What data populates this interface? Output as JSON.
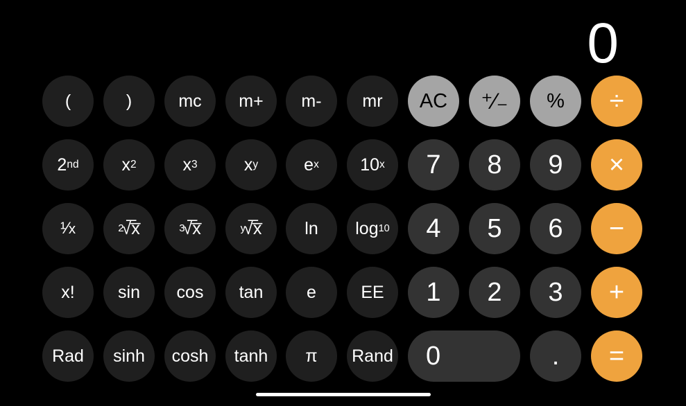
{
  "app": {
    "name": "Calculator",
    "mode": "scientific",
    "background_color": "#000000"
  },
  "display": {
    "value": "0"
  },
  "colors": {
    "function_key": "#1f1f1f",
    "light_key": "#a5a5a5",
    "digit_key": "#333333",
    "operator_key": "#efa33e",
    "text_light": "#ffffff",
    "text_dark": "#000000"
  },
  "keypad": {
    "rows": [
      {
        "keys": [
          {
            "label": "(",
            "name": "key-open-paren",
            "style": "func"
          },
          {
            "label": ")",
            "name": "key-close-paren",
            "style": "func"
          },
          {
            "label": "mc",
            "name": "key-memory-clear",
            "style": "func"
          },
          {
            "label": "m+",
            "name": "key-memory-add",
            "style": "func"
          },
          {
            "label": "m-",
            "name": "key-memory-subtract",
            "style": "func"
          },
          {
            "label": "mr",
            "name": "key-memory-recall",
            "style": "func"
          },
          {
            "label": "AC",
            "name": "key-all-clear",
            "style": "light"
          },
          {
            "label": "+/-",
            "name": "key-sign-toggle",
            "style": "light"
          },
          {
            "label": "%",
            "name": "key-percent",
            "style": "light"
          },
          {
            "label": "÷",
            "name": "key-divide",
            "style": "operator"
          }
        ]
      },
      {
        "keys": [
          {
            "label": "2nd",
            "name": "key-second-function",
            "style": "func"
          },
          {
            "label": "x2",
            "name": "key-x-squared",
            "style": "func"
          },
          {
            "label": "x3",
            "name": "key-x-cubed",
            "style": "func"
          },
          {
            "label": "xy",
            "name": "key-x-to-the-y",
            "style": "func"
          },
          {
            "label": "ex",
            "name": "key-e-to-the-x",
            "style": "func"
          },
          {
            "label": "10x",
            "name": "key-ten-to-the-x",
            "style": "func"
          },
          {
            "label": "7",
            "name": "key-7",
            "style": "digit"
          },
          {
            "label": "8",
            "name": "key-8",
            "style": "digit"
          },
          {
            "label": "9",
            "name": "key-9",
            "style": "digit"
          },
          {
            "label": "×",
            "name": "key-multiply",
            "style": "operator"
          }
        ]
      },
      {
        "keys": [
          {
            "label": "1/x",
            "name": "key-reciprocal",
            "style": "func"
          },
          {
            "label": "2√x",
            "name": "key-square-root",
            "style": "func"
          },
          {
            "label": "3√x",
            "name": "key-cube-root",
            "style": "func"
          },
          {
            "label": "y√x",
            "name": "key-y-root-of-x",
            "style": "func"
          },
          {
            "label": "ln",
            "name": "key-natural-log",
            "style": "func"
          },
          {
            "label": "log10",
            "name": "key-log-base-10",
            "style": "func"
          },
          {
            "label": "4",
            "name": "key-4",
            "style": "digit"
          },
          {
            "label": "5",
            "name": "key-5",
            "style": "digit"
          },
          {
            "label": "6",
            "name": "key-6",
            "style": "digit"
          },
          {
            "label": "−",
            "name": "key-subtract",
            "style": "operator"
          }
        ]
      },
      {
        "keys": [
          {
            "label": "x!",
            "name": "key-factorial",
            "style": "func"
          },
          {
            "label": "sin",
            "name": "key-sine",
            "style": "func"
          },
          {
            "label": "cos",
            "name": "key-cosine",
            "style": "func"
          },
          {
            "label": "tan",
            "name": "key-tangent",
            "style": "func"
          },
          {
            "label": "e",
            "name": "key-euler-e",
            "style": "func"
          },
          {
            "label": "EE",
            "name": "key-exponent-ee",
            "style": "func"
          },
          {
            "label": "1",
            "name": "key-1",
            "style": "digit"
          },
          {
            "label": "2",
            "name": "key-2",
            "style": "digit"
          },
          {
            "label": "3",
            "name": "key-3",
            "style": "digit"
          },
          {
            "label": "+",
            "name": "key-add",
            "style": "operator"
          }
        ]
      },
      {
        "keys": [
          {
            "label": "Rad",
            "name": "key-radians-toggle",
            "style": "func"
          },
          {
            "label": "sinh",
            "name": "key-hyperbolic-sine",
            "style": "func"
          },
          {
            "label": "cosh",
            "name": "key-hyperbolic-cosine",
            "style": "func"
          },
          {
            "label": "tanh",
            "name": "key-hyperbolic-tangent",
            "style": "func"
          },
          {
            "label": "π",
            "name": "key-pi",
            "style": "func"
          },
          {
            "label": "Rand",
            "name": "key-random",
            "style": "func"
          },
          {
            "label": "0",
            "name": "key-0",
            "style": "digit-wide"
          },
          {
            "label": ".",
            "name": "key-decimal-point",
            "style": "digit"
          },
          {
            "label": "=",
            "name": "key-equals",
            "style": "operator"
          }
        ]
      }
    ]
  },
  "system": {
    "home_indicator": "home-indicator"
  }
}
